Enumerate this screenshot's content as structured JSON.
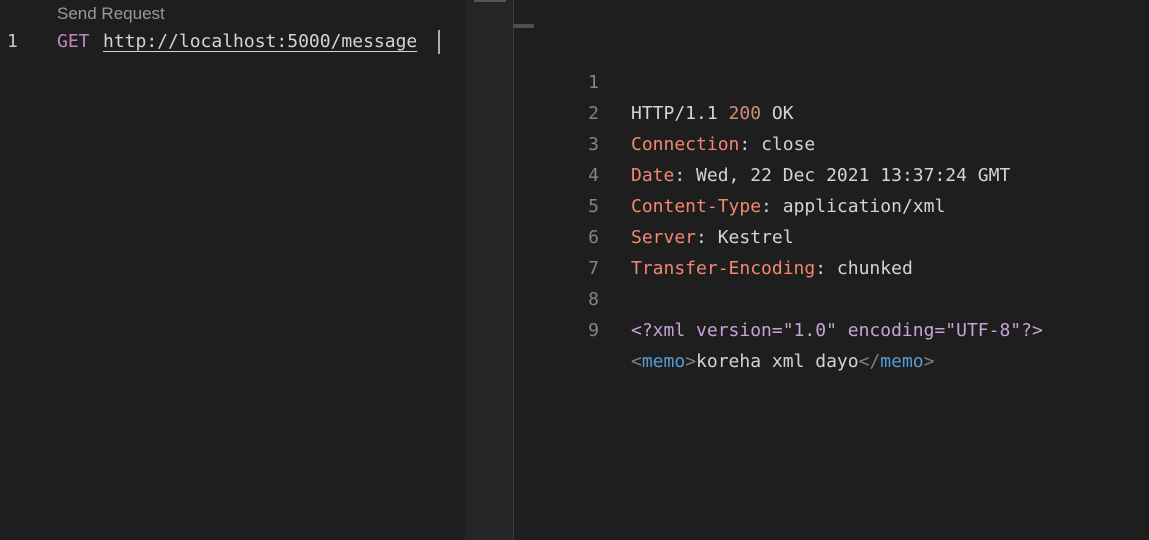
{
  "request_editor": {
    "codelens_label": "Send Request",
    "line_number": "1",
    "method": "GET",
    "url": "http://localhost:5000/message"
  },
  "response_editor": {
    "lines": [
      {
        "num": "1",
        "http_version": "HTTP/1.1",
        "status_code": "200",
        "status_text": "OK"
      },
      {
        "num": "2",
        "name": "Connection",
        "value": "close"
      },
      {
        "num": "3",
        "name": "Date",
        "value": "Wed, 22 Dec 2021 13:37:24 GMT"
      },
      {
        "num": "4",
        "name": "Content-Type",
        "value": "application/xml"
      },
      {
        "num": "5",
        "name": "Server",
        "value": "Kestrel"
      },
      {
        "num": "6",
        "name": "Transfer-Encoding",
        "value": "chunked"
      },
      {
        "num": "7"
      },
      {
        "num": "8",
        "xml_declaration": "<?xml version=\"1.0\" encoding=\"UTF-8\"?>"
      },
      {
        "num": "9",
        "open_lt": "<",
        "open_tag": "memo",
        "open_gt": ">",
        "text": "koreha xml dayo",
        "close_lt": "</",
        "close_tag": "memo",
        "close_gt": ">"
      }
    ]
  }
}
